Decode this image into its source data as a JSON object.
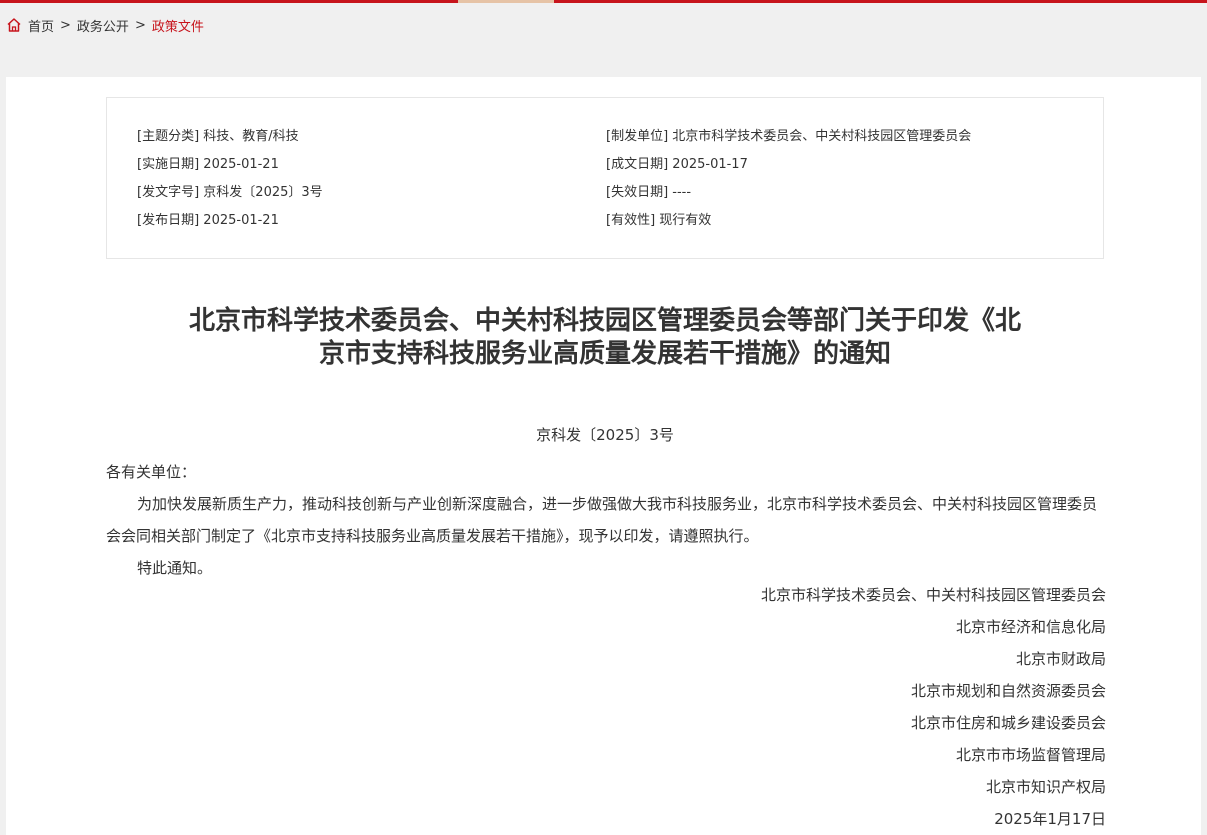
{
  "breadcrumb": {
    "home": "首页",
    "sep1": ">",
    "section": "政务公开",
    "sep2": ">",
    "current": "政策文件"
  },
  "meta": {
    "left": [
      {
        "key": "[主题分类]",
        "value": "科技、教育/科技"
      },
      {
        "key": "[实施日期]",
        "value": "2025-01-21"
      },
      {
        "key": "[发文字号]",
        "value": "京科发〔2025〕3号"
      },
      {
        "key": "[发布日期]",
        "value": "2025-01-21"
      }
    ],
    "right": [
      {
        "key": "[制发单位]",
        "value": "北京市科学技术委员会、中关村科技园区管理委员会"
      },
      {
        "key": "[成文日期]",
        "value": "2025-01-17"
      },
      {
        "key": "[失效日期]",
        "value": "----"
      },
      {
        "key": "[有效性]",
        "value": "现行有效"
      }
    ]
  },
  "document": {
    "title_line1": "北京市科学技术委员会、中关村科技园区管理委员会等部门关于印发《北",
    "title_line2": "京市支持科技服务业高质量发展若干措施》的通知",
    "number": "京科发〔2025〕3号",
    "salutation": "各有关单位：",
    "paragraph": "为加快发展新质生产力，推动科技创新与产业创新深度融合，进一步做强做大我市科技服务业，北京市科学技术委员会、中关村科技园区管理委员会会同相关部门制定了《北京市支持科技服务业高质量发展若干措施》，现予以印发，请遵照执行。",
    "closing": "特此通知。",
    "signers": [
      "北京市科学技术委员会、中关村科技园区管理委员会",
      "北京市经济和信息化局",
      "北京市财政局",
      "北京市规划和自然资源委员会",
      "北京市住房和城乡建设委员会",
      "北京市市场监督管理局",
      "北京市知识产权局",
      "2025年1月17日"
    ]
  },
  "colors": {
    "accent": "#c7141c",
    "text": "#333333",
    "background": "#f0f0f0"
  }
}
